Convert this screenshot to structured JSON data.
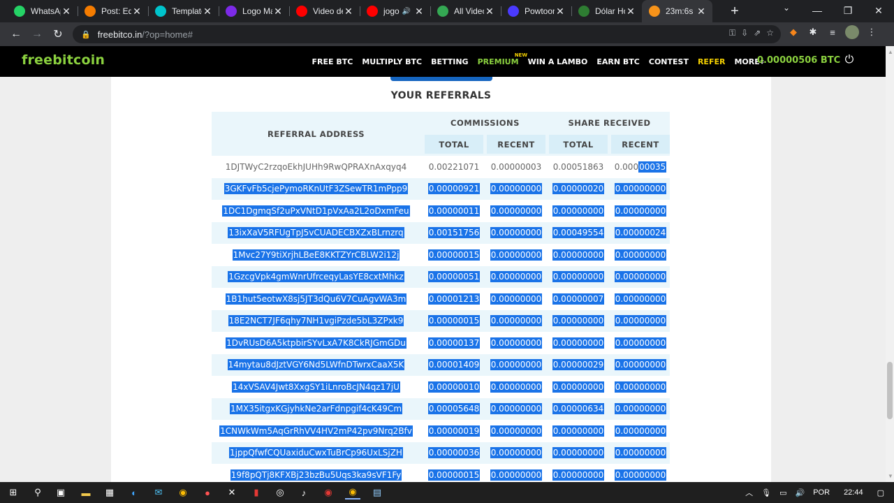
{
  "browser": {
    "tabs": [
      {
        "title": "WhatsApp",
        "icon": "whatsapp-icon",
        "color": "#25d366"
      },
      {
        "title": "Post: Edit",
        "icon": "blogger-icon",
        "color": "#f57c00"
      },
      {
        "title": "Template",
        "icon": "canva-icon",
        "color": "#00c4cc"
      },
      {
        "title": "Logo Maker",
        "icon": "canva-icon",
        "color": "#7d2ae8"
      },
      {
        "title": "Video de",
        "icon": "youtube-icon",
        "color": "#ff0000"
      },
      {
        "title": "jogo",
        "icon": "youtube-icon",
        "color": "#ff0000"
      },
      {
        "title": "All Video",
        "icon": "play-icon",
        "color": "#34a853"
      },
      {
        "title": "Powtoon",
        "icon": "powtoon-icon",
        "color": "#4a3aff"
      },
      {
        "title": "Dólar Hoje",
        "icon": "dollar-icon",
        "color": "#2e7d32"
      },
      {
        "title": "23m:6s",
        "icon": "bitcoin-icon",
        "color": "#f7931a"
      }
    ],
    "url_host": "freebitco.in",
    "url_path": "/?op=home#"
  },
  "site": {
    "logo": "freebitcoin",
    "menu": [
      "FREE BTC",
      "MULTIPLY BTC",
      "BETTING",
      "PREMIUM",
      "WIN A LAMBO",
      "EARN BTC",
      "CONTEST",
      "REFER",
      "MORE"
    ],
    "new_badge": "NEW",
    "balance": "0.00000506 BTC"
  },
  "referrals": {
    "title": "YOUR REFERRALS",
    "headers": {
      "address": "REFERRAL ADDRESS",
      "commissions": "COMMISSIONS",
      "share": "SHARE RECEIVED",
      "total": "TOTAL",
      "recent": "RECENT"
    },
    "first_row": {
      "address": "1DJTWyC2rzqoEkhJUHh9RwQPRAXnAxqyq4",
      "comm_total": "0.00221071",
      "comm_recent": "0.00000003",
      "share_total": "0.00051863",
      "share_recent_plain": "0.000",
      "share_recent_sel": "00035"
    },
    "rows": [
      [
        "3GKFvFb5cjePymoRKnUtF3ZSewTR1mPpp9",
        "0.00000921",
        "0.00000000",
        "0.00000020",
        "0.00000000"
      ],
      [
        "1DC1DgmqSf2uPxVNtD1pVxAa2L2oDxmFeu",
        "0.00000011",
        "0.00000000",
        "0.00000000",
        "0.00000000"
      ],
      [
        "13ixXaV5RFUgTpJ5vCUADECBXZxBLrnzrq",
        "0.00151756",
        "0.00000000",
        "0.00049554",
        "0.00000024"
      ],
      [
        "1Mvc27Y9tiXrjhLBeE8KKTZYrCBLW2i12j",
        "0.00000015",
        "0.00000000",
        "0.00000000",
        "0.00000000"
      ],
      [
        "1GzcgVpk4gmWnrUfrceqyLasYE8cxtMhkz",
        "0.00000051",
        "0.00000000",
        "0.00000000",
        "0.00000000"
      ],
      [
        "1B1hut5eotwX8sj5JT3dQu6V7CuAgvWA3m",
        "0.00001213",
        "0.00000000",
        "0.00000007",
        "0.00000000"
      ],
      [
        "18E2NCT7JF6qhy7NH1vgiPzde5bL3ZPxk9",
        "0.00000015",
        "0.00000000",
        "0.00000000",
        "0.00000000"
      ],
      [
        "1DvRUsD6A5ktpbirSYvLxA7K8CkRJGmGDu",
        "0.00000137",
        "0.00000000",
        "0.00000000",
        "0.00000000"
      ],
      [
        "14mytau8dJztVGY6Nd5LWfnDTwrxCaaX5K",
        "0.00001409",
        "0.00000000",
        "0.00000029",
        "0.00000000"
      ],
      [
        "14xVSAV4Jwt8XxgSY1iLnroBcJN4qz17jU",
        "0.00000010",
        "0.00000000",
        "0.00000000",
        "0.00000000"
      ],
      [
        "1MX35itgxKGjyhkNe2arFdnpgif4cK49Cm",
        "0.00005648",
        "0.00000000",
        "0.00000634",
        "0.00000000"
      ],
      [
        "1CNWkWm5AqGrRhVV4HV2mP42pv9Nrq2Bfv",
        "0.00000019",
        "0.00000000",
        "0.00000000",
        "0.00000000"
      ],
      [
        "1jppQfwfCQUaxiduCwxTuBrCp96UxLSjZH",
        "0.00000036",
        "0.00000000",
        "0.00000000",
        "0.00000000"
      ],
      [
        "19f8pQTj8KFXBj23bzBu5Uqs3ka9sVF1Fy",
        "0.00000015",
        "0.00000000",
        "0.00000000",
        "0.00000000"
      ]
    ]
  },
  "taskbar": {
    "language": "POR",
    "time": "22:44"
  },
  "colors": {
    "brand_green": "#8bd13f",
    "refer_yellow": "#f5d100",
    "selection": "#1a73e8",
    "row_stripe": "#eaf6fb"
  }
}
